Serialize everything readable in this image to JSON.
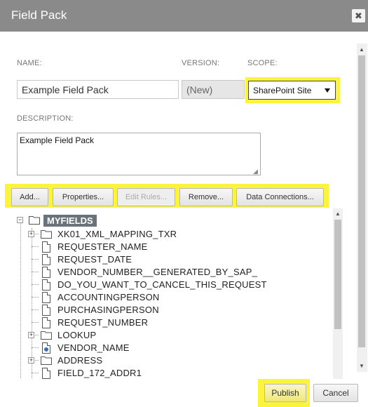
{
  "dialog": {
    "title": "Field Pack",
    "close_glyph": "✖"
  },
  "form": {
    "name_label": "NAME:",
    "name_value": "Example Field Pack",
    "version_label": "VERSION:",
    "version_value": "(New)",
    "scope_label": "SCOPE:",
    "scope_value": "SharePoint Site",
    "description_label": "DESCRIPTION:",
    "description_value": "Example Field Pack"
  },
  "toolbar": {
    "add": "Add...",
    "properties": "Properties...",
    "edit_rules": "Edit Rules...",
    "remove": "Remove...",
    "data_connections": "Data Connections..."
  },
  "tree": {
    "root": "MYFIELDS",
    "items": [
      {
        "label": "XK01_XML_MAPPING_TXR",
        "type": "folder",
        "expandable": true
      },
      {
        "label": "REQUESTER_NAME",
        "type": "field",
        "expandable": false
      },
      {
        "label": "REQUEST_DATE",
        "type": "field",
        "expandable": false
      },
      {
        "label": "VENDOR_NUMBER__GENERATED_BY_SAP_",
        "type": "field",
        "expandable": false
      },
      {
        "label": "DO_YOU_WANT_TO_CANCEL_THIS_REQUEST",
        "type": "field",
        "expandable": false
      },
      {
        "label": "ACCOUNTINGPERSON",
        "type": "field",
        "expandable": false
      },
      {
        "label": "PURCHASINGPERSON",
        "type": "field",
        "expandable": false
      },
      {
        "label": "REQUEST_NUMBER",
        "type": "field",
        "expandable": false
      },
      {
        "label": "LOOKUP",
        "type": "folder",
        "expandable": true
      },
      {
        "label": "VENDOR_NAME",
        "type": "lookup-field",
        "expandable": false
      },
      {
        "label": "ADDRESS",
        "type": "folder",
        "expandable": true
      },
      {
        "label": "FIELD_172_ADDR1",
        "type": "field",
        "expandable": false
      }
    ]
  },
  "footer": {
    "publish": "Publish",
    "cancel": "Cancel"
  },
  "colors": {
    "highlight": "#fbf33c",
    "titlebar": "#8a8a8a",
    "root_badge": "#69737d"
  },
  "icons": [
    "close-icon",
    "folder-icon",
    "field-icon",
    "lookup-field-icon",
    "expand-icon",
    "collapse-icon",
    "dropdown-arrow-icon"
  ]
}
